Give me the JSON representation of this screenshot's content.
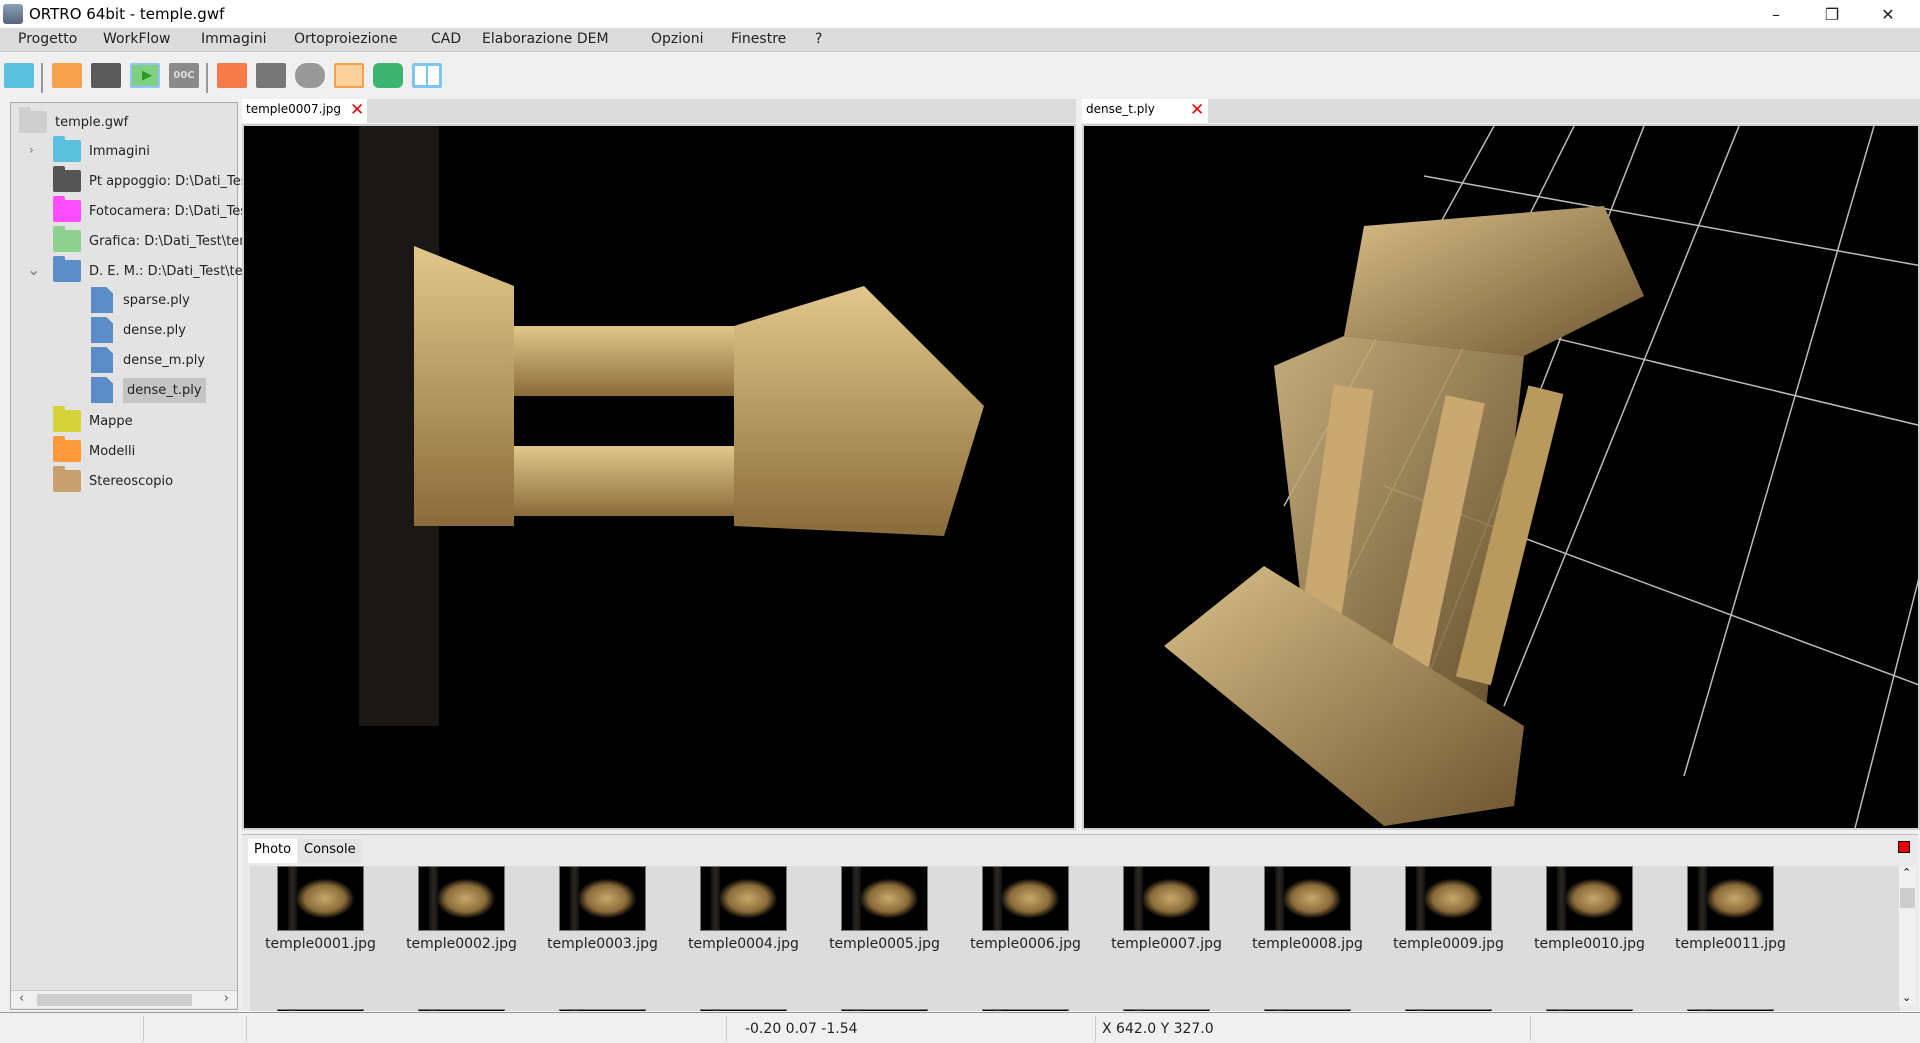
{
  "window": {
    "title": "ORTRO 64bit - temple.gwf",
    "minimize": "–",
    "maximize": "❐",
    "close": "✕"
  },
  "menu": [
    "Progetto",
    "WorkFlow",
    "Immagini",
    "Ortoproiezione",
    "CAD",
    "Elaborazione DEM",
    "Opzioni",
    "Finestre",
    "?"
  ],
  "toolbar": {
    "icons": [
      "open-project-icon",
      "image-icon",
      "terrain-icon",
      "play-icon",
      "00c-icon",
      "point-cloud-icon",
      "dem-icon",
      "mesh-icon",
      "tools-icon",
      "eye-icon",
      "split-view-icon"
    ],
    "label_00c": "00C"
  },
  "tree": {
    "root": "temple.gwf",
    "nodes": [
      {
        "label": "Immagini",
        "color": "#5bc0de",
        "expander": "›"
      },
      {
        "label": "Pt appoggio: D:\\Dati_Tes",
        "color": "#555555"
      },
      {
        "label": "Fotocamera: D:\\Dati_Tes",
        "color": "#ff4dff"
      },
      {
        "label": "Grafica: D:\\Dati_Test\\ter",
        "color": "#8ed18e"
      },
      {
        "label": "D. E. M.: D:\\Dati_Test\\te",
        "color": "#5b8ec8",
        "expander": "⌄"
      },
      {
        "label": "Mappe",
        "color": "#d4d43a"
      },
      {
        "label": "Modelli",
        "color": "#ff9a3c"
      },
      {
        "label": "Stereoscopio",
        "color": "#c8a070"
      }
    ],
    "dem_files": [
      "sparse.ply",
      "dense.ply",
      "dense_m.ply",
      "dense_t.ply"
    ],
    "selected": "dense_t.ply"
  },
  "tabs": {
    "left": "temple0007.jpg",
    "right": "dense_t.ply",
    "close": "✕"
  },
  "bottom": {
    "tabs": [
      "Photo",
      "Console"
    ],
    "active": "Photo",
    "photos": [
      "temple0001.jpg",
      "temple0002.jpg",
      "temple0003.jpg",
      "temple0004.jpg",
      "temple0005.jpg",
      "temple0006.jpg",
      "temple0007.jpg",
      "temple0008.jpg",
      "temple0009.jpg",
      "temple0010.jpg",
      "temple0011.jpg"
    ]
  },
  "status": {
    "coords3d": "-0.20 0.07 -1.54",
    "pixel": "X 642.0  Y 327.0"
  }
}
